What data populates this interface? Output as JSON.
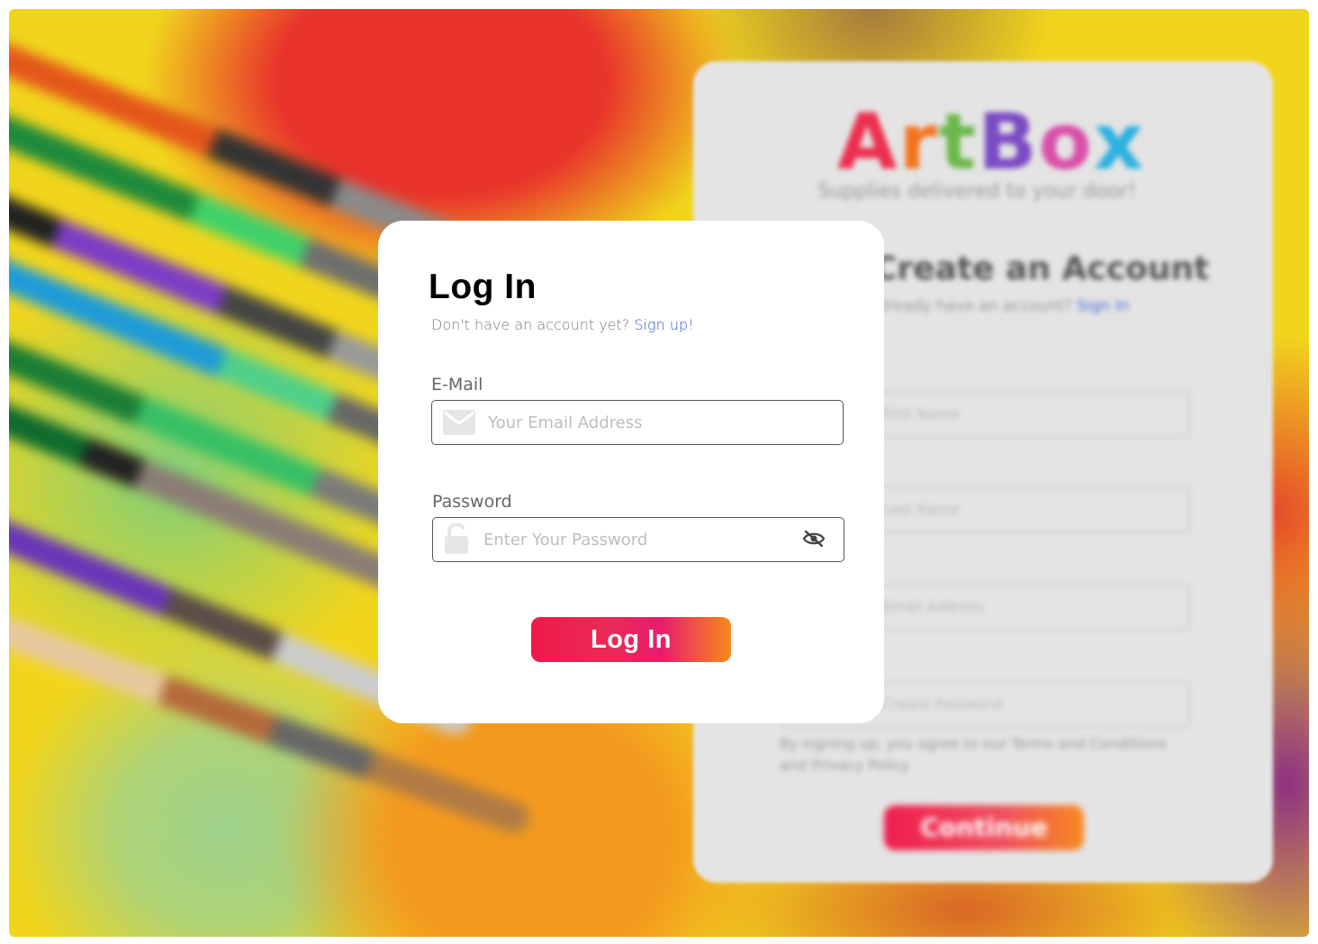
{
  "background": {
    "logo_letters": [
      "A",
      "r",
      "t",
      "B",
      "o",
      "x"
    ],
    "tagline": "Supplies delivered to your door!",
    "heading": "Create an Account",
    "subtext": "Already have an account?",
    "subtext_link": "Sign In",
    "field_placeholders": [
      "First Name",
      "Last Name",
      "Email Address",
      "Create Password"
    ],
    "terms": "By signing up, you agree to our Terms and Conditions and Privacy Policy",
    "continue_label": "Continue"
  },
  "login": {
    "title": "Log In",
    "signup_prompt": "Don't have an account yet?",
    "signup_link": "Sign up!",
    "email_label": "E-Mail",
    "email_placeholder": "Your Email Address",
    "email_icon": "envelope-icon",
    "password_label": "Password",
    "password_placeholder": "Enter Your Password",
    "password_icon": "unlock-icon",
    "visibility_icon": "eye-slash-icon",
    "submit_label": "Log In"
  },
  "colors": {
    "button_gradient_start": "#ef1a4a",
    "button_gradient_end": "#f78a1c",
    "link": "#2f58c9"
  }
}
